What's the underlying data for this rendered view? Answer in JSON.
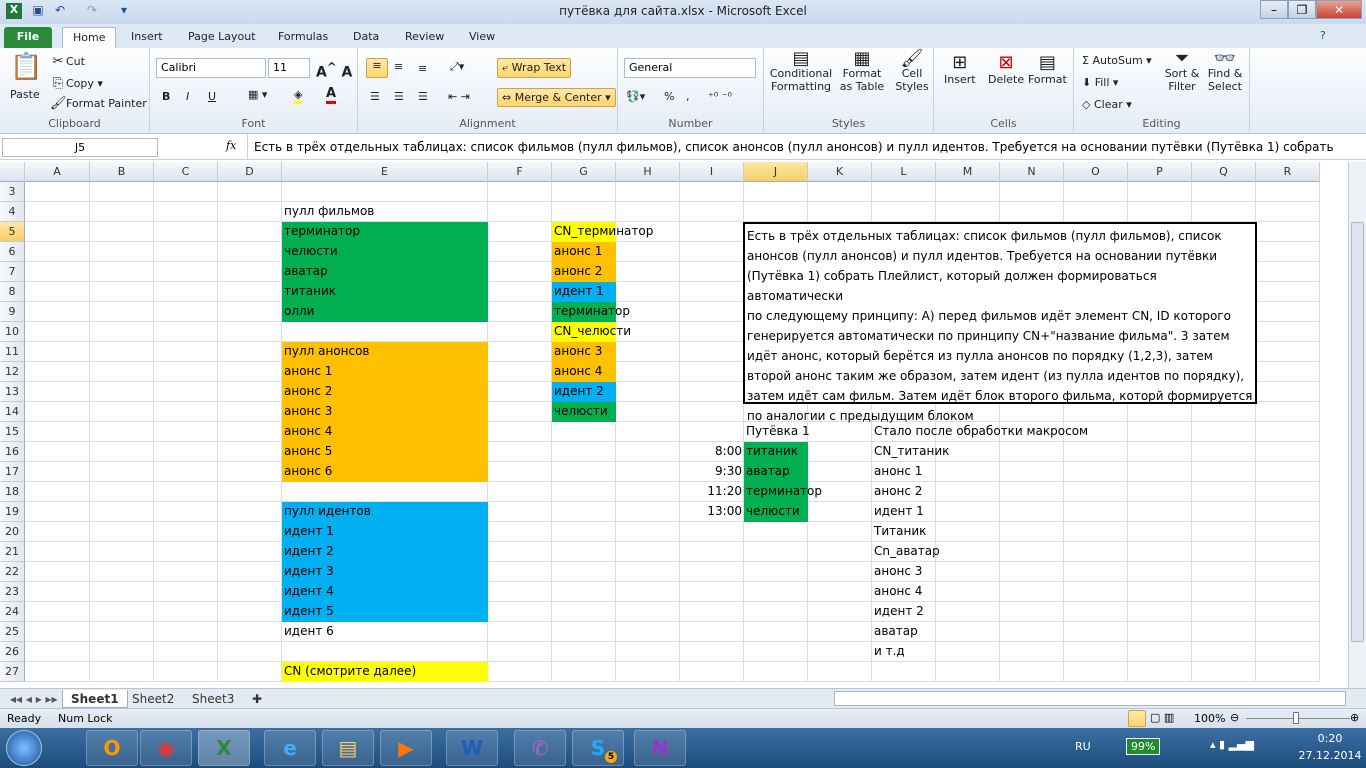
{
  "window": {
    "title": "путёвка для сайта.xlsx - Microsoft Excel"
  },
  "tabs": [
    "File",
    "Home",
    "Insert",
    "Page Layout",
    "Formulas",
    "Data",
    "Review",
    "View"
  ],
  "ribbon": {
    "clipboard": {
      "label": "Clipboard",
      "paste": "Paste",
      "cut": "Cut",
      "copy": "Copy",
      "format_painter": "Format Painter"
    },
    "font": {
      "label": "Font",
      "name": "Calibri",
      "size": "11",
      "bold": "B",
      "italic": "I",
      "underline": "U"
    },
    "alignment": {
      "label": "Alignment",
      "wrap": "Wrap Text",
      "merge": "Merge & Center"
    },
    "number": {
      "label": "Number",
      "format": "General",
      "percent": "%",
      "comma": ","
    },
    "styles": {
      "label": "Styles",
      "conditional": "Conditional Formatting",
      "table": "Format as Table",
      "cell": "Cell Styles"
    },
    "cells": {
      "label": "Cells",
      "insert": "Insert",
      "delete": "Delete",
      "format": "Format"
    },
    "editing": {
      "label": "Editing",
      "autosum": "AutoSum",
      "fill": "Fill",
      "clear": "Clear",
      "sort": "Sort & Filter",
      "find": "Find & Select"
    }
  },
  "formula_bar": {
    "name_box": "J5",
    "fx": "fx",
    "value": "Есть в трёх отдельных таблицах: список фильмов (пулл фильмов), список анонсов (пулл анонсов) и пулл идентов. Требуется на основании путёвки (Путёвка 1) собрать"
  },
  "columns": [
    "A",
    "B",
    "C",
    "D",
    "E",
    "F",
    "G",
    "H",
    "I",
    "J",
    "K",
    "L",
    "M",
    "N",
    "O",
    "P",
    "Q",
    "R"
  ],
  "rows": [
    3,
    4,
    5,
    6,
    7,
    8,
    9,
    10,
    11,
    12,
    13,
    14,
    15,
    16,
    17,
    18,
    19,
    20,
    21,
    22,
    23,
    24,
    25,
    26,
    27
  ],
  "colors": {
    "green": "#00b050",
    "orange": "#ffc000",
    "blue": "#00b0f0",
    "yellow": "#ffff00"
  },
  "cells": [
    {
      "ref": "E4",
      "text": "пулл фильмов"
    },
    {
      "ref": "E5",
      "text": "терминатор",
      "fill": "green"
    },
    {
      "ref": "E6",
      "text": "челюсти",
      "fill": "green"
    },
    {
      "ref": "E7",
      "text": "аватар",
      "fill": "green"
    },
    {
      "ref": "E8",
      "text": "титаник",
      "fill": "green"
    },
    {
      "ref": "E9",
      "text": "олли",
      "fill": "green"
    },
    {
      "ref": "E11",
      "text": "пулл анонсов",
      "fill": "orange"
    },
    {
      "ref": "E12",
      "text": "анонс 1",
      "fill": "orange"
    },
    {
      "ref": "E13",
      "text": "анонс 2",
      "fill": "orange"
    },
    {
      "ref": "E14",
      "text": "анонс 3",
      "fill": "orange"
    },
    {
      "ref": "E15",
      "text": "анонс 4",
      "fill": "orange"
    },
    {
      "ref": "E16",
      "text": "анонс 5",
      "fill": "orange"
    },
    {
      "ref": "E17",
      "text": "анонс 6",
      "fill": "orange"
    },
    {
      "ref": "E19",
      "text": "пулл идентов",
      "fill": "blue"
    },
    {
      "ref": "E20",
      "text": "идент 1",
      "fill": "blue"
    },
    {
      "ref": "E21",
      "text": "идент 2",
      "fill": "blue"
    },
    {
      "ref": "E22",
      "text": "идент 3",
      "fill": "blue"
    },
    {
      "ref": "E23",
      "text": "идент 4",
      "fill": "blue"
    },
    {
      "ref": "E24",
      "text": "идент 5",
      "fill": "blue"
    },
    {
      "ref": "E25",
      "text": "идент 6"
    },
    {
      "ref": "E27",
      "text": "CN (смотрите далее)",
      "fill": "yellow"
    },
    {
      "ref": "G5",
      "text": "CN_терминатор",
      "fill": "yellow"
    },
    {
      "ref": "G6",
      "text": "анонс 1",
      "fill": "orange"
    },
    {
      "ref": "G7",
      "text": "анонс 2",
      "fill": "orange"
    },
    {
      "ref": "G8",
      "text": "идент 1",
      "fill": "blue"
    },
    {
      "ref": "G9",
      "text": "терминатор",
      "fill": "green"
    },
    {
      "ref": "G10",
      "text": "CN_челюсти",
      "fill": "yellow"
    },
    {
      "ref": "G11",
      "text": "анонс 3",
      "fill": "orange"
    },
    {
      "ref": "G12",
      "text": "анонс 4",
      "fill": "orange"
    },
    {
      "ref": "G13",
      "text": "идент 2",
      "fill": "blue"
    },
    {
      "ref": "G14",
      "text": "челюсти",
      "fill": "green"
    },
    {
      "ref": "J15",
      "text": "Путёвка 1"
    },
    {
      "ref": "I16",
      "text": "8:00",
      "align": "right"
    },
    {
      "ref": "I17",
      "text": "9:30",
      "align": "right"
    },
    {
      "ref": "I18",
      "text": "11:20",
      "align": "right"
    },
    {
      "ref": "I19",
      "text": "13:00",
      "align": "right"
    },
    {
      "ref": "J16",
      "text": "титаник",
      "fill": "green"
    },
    {
      "ref": "J17",
      "text": "аватар",
      "fill": "green"
    },
    {
      "ref": "J18",
      "text": "терминатор",
      "fill": "green"
    },
    {
      "ref": "J19",
      "text": "челюсти",
      "fill": "green"
    },
    {
      "ref": "L15",
      "text": "Стало после обработки макросом"
    },
    {
      "ref": "L16",
      "text": "CN_титаник"
    },
    {
      "ref": "L17",
      "text": "анонс 1"
    },
    {
      "ref": "L18",
      "text": "анонс 2"
    },
    {
      "ref": "L19",
      "text": "идент 1"
    },
    {
      "ref": "L20",
      "text": "Титаник"
    },
    {
      "ref": "L21",
      "text": "Cn_аватар"
    },
    {
      "ref": "L22",
      "text": "анонс 3"
    },
    {
      "ref": "L23",
      "text": "анонс 4"
    },
    {
      "ref": "L24",
      "text": "идент 2"
    },
    {
      "ref": "L25",
      "text": "аватар"
    },
    {
      "ref": "L26",
      "text": "и т.д"
    }
  ],
  "textbox": {
    "lines": [
      "Есть в трёх отдельных таблицах: список фильмов (пулл фильмов), список",
      "анонсов (пулл анонсов) и пулл идентов. Требуется на основании путёвки",
      "(Путёвка 1) собрать Плейлист, который должен формироваться автоматически",
      "по следующему принципу: А) перед фильмов идёт элемент CN, ID которого",
      "генерируется автоматически по принципу CN+\"название фильма\". 3 затем",
      "идёт анонс, который берётся из пулла анонсов по порядку (1,2,3), затем",
      "второй анонс таким же образом, затем идент (из пулла идентов по порядку),",
      "затем идёт сам фильм. Затем идёт блок второго фильма, которй формируется",
      "по аналогии с предыдущим блоком"
    ]
  },
  "sheets": [
    "Sheet1",
    "Sheet2",
    "Sheet3"
  ],
  "active_sheet": "Sheet1",
  "status": {
    "ready": "Ready",
    "numlock": "Num Lock",
    "zoom": "100%"
  },
  "taskbar": {
    "apps": [
      "outlook",
      "chrome",
      "excel",
      "internet-explorer",
      "file-explorer",
      "media-player",
      "word",
      "viber",
      "skype",
      "onenote"
    ],
    "skype_badge": "5",
    "lang": "RU",
    "battery": "99%",
    "time": "0:20",
    "date": "27.12.2014"
  }
}
